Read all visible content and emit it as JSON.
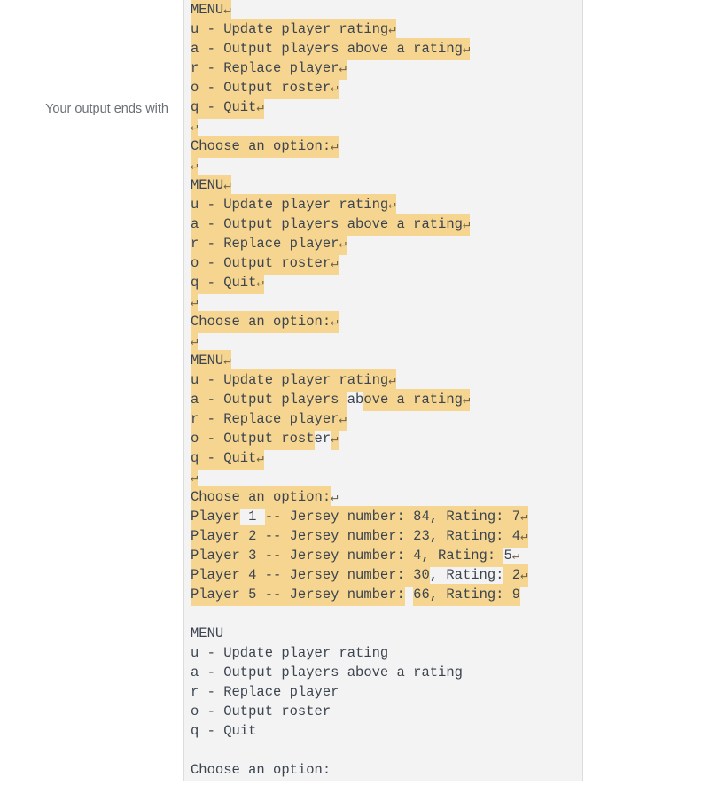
{
  "label": {
    "text": "Your output ends with"
  },
  "colors": {
    "highlight": "#f5d58f",
    "panel_bg": "#f3f3f3",
    "panel_border": "#dcdcdc",
    "text": "#3c4450",
    "label_text": "#6b6f76",
    "return_glyph": "#6e6045"
  },
  "glyphs": {
    "return": "↵"
  },
  "terminal": {
    "menu_title": "MENU",
    "menu_options": [
      "u - Update player rating",
      "a - Output players above a rating",
      "r - Replace player",
      "o - Output roster",
      "q - Quit"
    ],
    "prompt": "Choose an option:",
    "roster": [
      "Player 1 -- Jersey number: 84, Rating: 7",
      "Player 2 -- Jersey number: 23, Rating: 4",
      "Player 3 -- Jersey number: 4, Rating: 5",
      "Player 4 -- Jersey number: 30, Rating: 2",
      "Player 5 -- Jersey number: 66, Rating: 9"
    ],
    "lines": [
      {
        "id": "l1",
        "segments": [
          {
            "t": "MENU",
            "h": true,
            "r": true
          }
        ]
      },
      {
        "id": "l2",
        "segments": [
          {
            "t": "u - Update player rating",
            "h": true,
            "r": true
          }
        ]
      },
      {
        "id": "l3",
        "segments": [
          {
            "t": "a - Output players above a rating",
            "h": true,
            "r": true
          }
        ]
      },
      {
        "id": "l4",
        "segments": [
          {
            "t": "r - Replace player",
            "h": true,
            "r": true
          }
        ]
      },
      {
        "id": "l5",
        "segments": [
          {
            "t": "o - Output roster",
            "h": true,
            "r": true
          }
        ]
      },
      {
        "id": "l6",
        "segments": [
          {
            "t": "q - Quit",
            "h": true,
            "r": true
          }
        ]
      },
      {
        "id": "l7",
        "segments": [
          {
            "t": "",
            "h": true,
            "r": true
          }
        ]
      },
      {
        "id": "l8",
        "segments": [
          {
            "t": "Choose an option:",
            "h": true,
            "r": true
          }
        ]
      },
      {
        "id": "l9",
        "segments": [
          {
            "t": "",
            "h": true,
            "r": true
          }
        ]
      },
      {
        "id": "l10",
        "segments": [
          {
            "t": "MENU",
            "h": true,
            "r": true
          }
        ]
      },
      {
        "id": "l11",
        "segments": [
          {
            "t": "u - Update player rating",
            "h": true,
            "r": true
          }
        ]
      },
      {
        "id": "l12",
        "segments": [
          {
            "t": "a - Output players above a rating",
            "h": true,
            "r": true
          }
        ]
      },
      {
        "id": "l13",
        "segments": [
          {
            "t": "r - Replace player",
            "h": true,
            "r": true
          }
        ]
      },
      {
        "id": "l14",
        "segments": [
          {
            "t": "o - Output roster",
            "h": true,
            "r": true
          }
        ]
      },
      {
        "id": "l15",
        "segments": [
          {
            "t": "q - Quit",
            "h": true,
            "r": true
          }
        ]
      },
      {
        "id": "l16",
        "segments": [
          {
            "t": "",
            "h": true,
            "r": true
          }
        ]
      },
      {
        "id": "l17",
        "segments": [
          {
            "t": "Choose an option:",
            "h": true,
            "r": true
          }
        ]
      },
      {
        "id": "l18",
        "segments": [
          {
            "t": "",
            "h": true,
            "r": true
          }
        ]
      },
      {
        "id": "l19",
        "segments": [
          {
            "t": "MENU",
            "h": true,
            "r": true
          }
        ]
      },
      {
        "id": "l20",
        "segments": [
          {
            "t": "u - Update player rating",
            "h": true,
            "r": true
          }
        ]
      },
      {
        "id": "l21",
        "segments": [
          {
            "t": "a - Output players ",
            "h": true
          },
          {
            "t": "ab",
            "h": false
          },
          {
            "t": "ove a rating",
            "h": true,
            "r": true
          }
        ]
      },
      {
        "id": "l22",
        "segments": [
          {
            "t": "r - Replace player",
            "h": true,
            "r": true
          }
        ]
      },
      {
        "id": "l23",
        "segments": [
          {
            "t": "o - Output rost",
            "h": true
          },
          {
            "t": "er",
            "h": false
          },
          {
            "t": "",
            "h": true,
            "r": true
          }
        ]
      },
      {
        "id": "l24",
        "segments": [
          {
            "t": "q - Quit",
            "h": true,
            "r": true
          }
        ]
      },
      {
        "id": "l25",
        "segments": [
          {
            "t": "",
            "h": true,
            "r": true
          }
        ]
      },
      {
        "id": "l26",
        "segments": [
          {
            "t": "Choose an option:",
            "h": true
          },
          {
            "t": "",
            "h": false,
            "r": true
          }
        ]
      },
      {
        "id": "l27",
        "segments": [
          {
            "t": "Player",
            "h": true
          },
          {
            "t": " 1 ",
            "h": false
          },
          {
            "t": "-- Jersey number: 84, Rating: 7",
            "h": true,
            "r": true
          }
        ]
      },
      {
        "id": "l28",
        "segments": [
          {
            "t": "Player 2 -- Jersey number: 23, Rating: 4",
            "h": true,
            "r": true
          }
        ]
      },
      {
        "id": "l29",
        "segments": [
          {
            "t": "Player 3 -- Jersey number: 4, Rating: ",
            "h": true
          },
          {
            "t": "5",
            "h": false,
            "r": true
          }
        ]
      },
      {
        "id": "l30",
        "segments": [
          {
            "t": "Player 4 -- Jersey number: 30",
            "h": true
          },
          {
            "t": ", Rating:",
            "h": false
          },
          {
            "t": " 2",
            "h": true,
            "r": true
          }
        ]
      },
      {
        "id": "l31",
        "segments": [
          {
            "t": "Player 5 -- Jersey number:",
            "h": true
          },
          {
            "t": " ",
            "h": false
          },
          {
            "t": "66",
            "h": true
          },
          {
            "t": "",
            "h": false
          },
          {
            "t": ", Rating: 9",
            "h": true
          }
        ]
      },
      {
        "id": "l32",
        "segments": [
          {
            "t": ""
          }
        ]
      },
      {
        "id": "l33",
        "segments": [
          {
            "t": "MENU"
          }
        ]
      },
      {
        "id": "l34",
        "segments": [
          {
            "t": "u - Update player rating"
          }
        ]
      },
      {
        "id": "l35",
        "segments": [
          {
            "t": "a - Output players above a rating"
          }
        ]
      },
      {
        "id": "l36",
        "segments": [
          {
            "t": "r - Replace player"
          }
        ]
      },
      {
        "id": "l37",
        "segments": [
          {
            "t": "o - Output roster"
          }
        ]
      },
      {
        "id": "l38",
        "segments": [
          {
            "t": "q - Quit"
          }
        ]
      },
      {
        "id": "l39",
        "segments": [
          {
            "t": ""
          }
        ]
      },
      {
        "id": "l40",
        "segments": [
          {
            "t": "Choose an option:"
          }
        ]
      }
    ]
  }
}
